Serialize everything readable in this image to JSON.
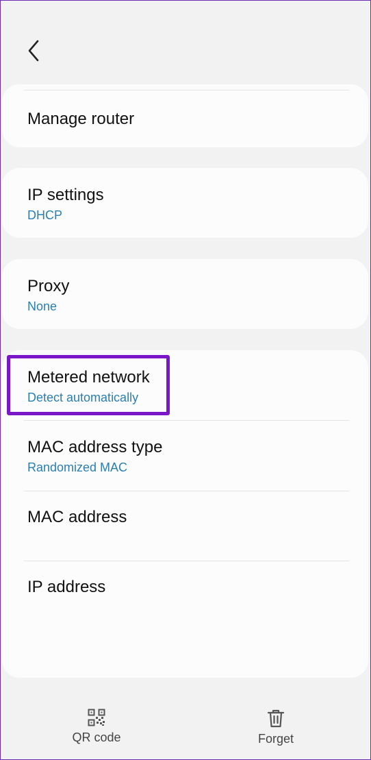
{
  "nav": {
    "back_icon": "chevron-left-icon"
  },
  "settings": {
    "manage_router": {
      "title": "Manage router"
    },
    "ip_settings": {
      "title": "IP settings",
      "value": "DHCP"
    },
    "proxy": {
      "title": "Proxy",
      "value": "None"
    },
    "metered_network": {
      "title": "Metered network",
      "value": "Detect automatically"
    },
    "mac_address_type": {
      "title": "MAC address type",
      "value": "Randomized MAC"
    },
    "mac_address": {
      "title": "MAC address"
    },
    "ip_address": {
      "title": "IP address"
    }
  },
  "bottom_bar": {
    "qr_code": {
      "label": "QR code",
      "icon": "qr-code-icon"
    },
    "forget": {
      "label": "Forget",
      "icon": "trash-icon"
    }
  },
  "colors": {
    "background": "#f2f2f2",
    "card": "#fcfcfc",
    "subtitle_blue": "#2a7fae",
    "highlight_purple": "#7a17c9"
  }
}
